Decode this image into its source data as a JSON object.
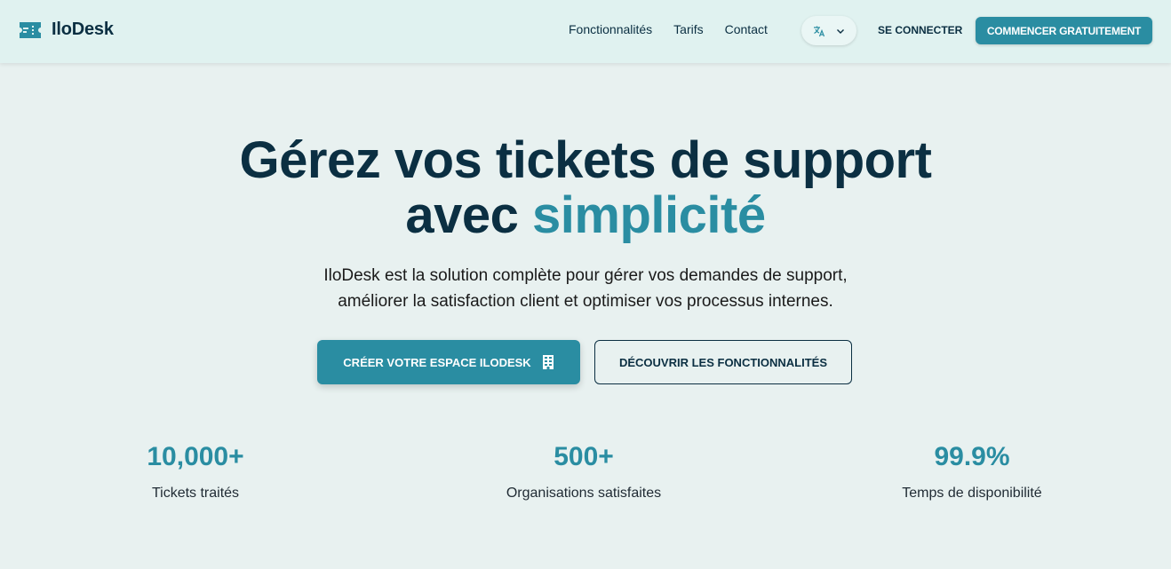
{
  "brand": {
    "name": "IloDesk",
    "icon": "ticket-icon",
    "color": "#2a8da2"
  },
  "nav": {
    "links": [
      "Fonctionnalités",
      "Tarifs",
      "Contact"
    ],
    "language_icon": "translate-icon",
    "login_label": "SE CONNECTER",
    "cta_label": "COMMENCER GRATUITEMENT"
  },
  "hero": {
    "title_line1": "Gérez vos tickets de support",
    "title_line2_prefix": "avec",
    "title_line2_accent": "simplicité",
    "subtitle_line1": "IloDesk est la solution complète pour gérer vos demandes de support,",
    "subtitle_line2": "améliorer la satisfaction client et optimiser vos processus internes.",
    "primary_button": "CRÉER VOTRE ESPACE ILODESK",
    "primary_button_icon": "building-icon",
    "secondary_button": "DÉCOUVRIR LES FONCTIONNALITÉS"
  },
  "stats": [
    {
      "value": "10,000+",
      "label": "Tickets traités"
    },
    {
      "value": "500+",
      "label": "Organisations satisfaites"
    },
    {
      "value": "99.9%",
      "label": "Temps de disponibilité"
    }
  ],
  "colors": {
    "accent": "#2a8da2",
    "dark": "#0b2f42",
    "nav_bg": "#e0f2f0",
    "page_bg": "#e8f1f0"
  }
}
